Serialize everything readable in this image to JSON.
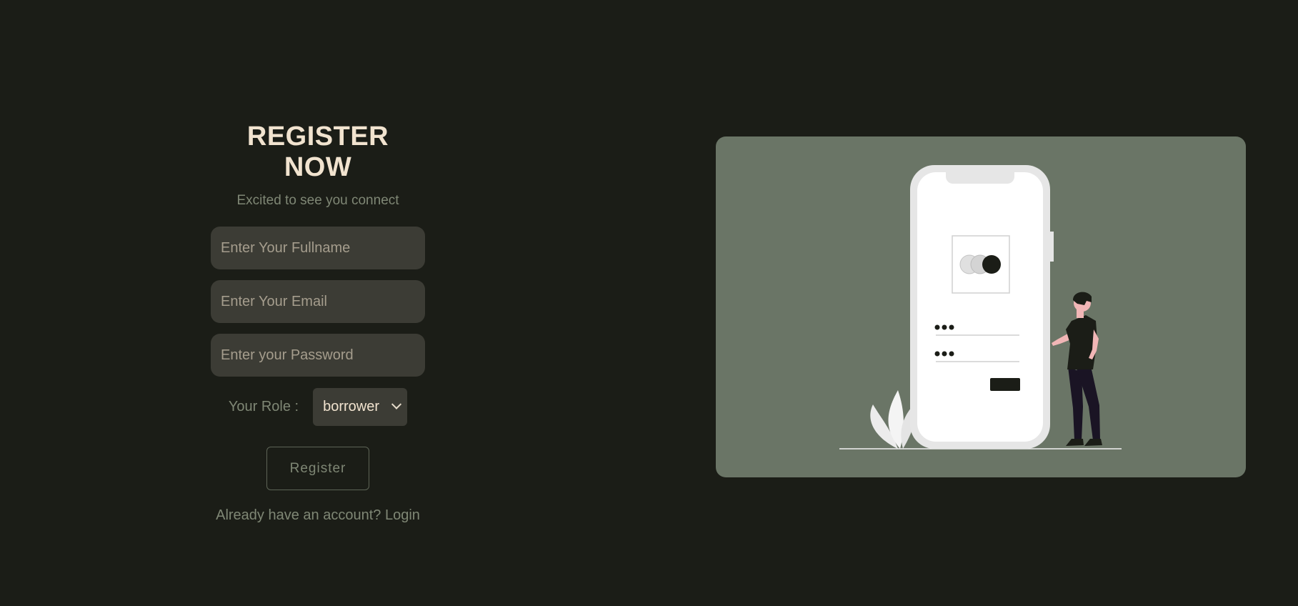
{
  "form": {
    "title": "REGISTER NOW",
    "subtitle": "Excited to see you connect",
    "fullname_placeholder": "Enter Your Fullname",
    "email_placeholder": "Enter Your Email",
    "password_placeholder": "Enter your Password",
    "role_label": "Your Role :",
    "role_selected": "borrower",
    "register_label": "Register",
    "login_prompt": "Already have an account?",
    "login_link": "Login"
  },
  "colors": {
    "background": "#1b1d17",
    "title": "#f1e3cf",
    "muted_text": "#7f8775",
    "field_bg": "#3c3c35",
    "panel_bg": "#6a7566"
  },
  "illustration": {
    "icon": "phone-login-illustration"
  }
}
